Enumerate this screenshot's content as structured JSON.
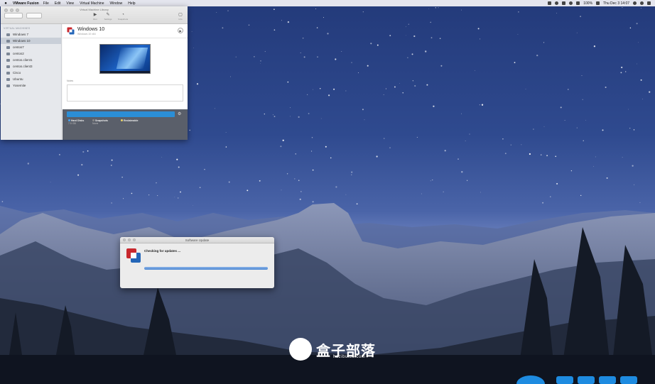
{
  "menubar": {
    "app_name": "VMware Fusion",
    "menus": [
      "File",
      "Edit",
      "View",
      "Virtual Machine",
      "Window",
      "Help"
    ],
    "battery": "100%",
    "clock": "Thu Dec 3 14:07"
  },
  "library": {
    "window_title": "Virtual Machine Library",
    "toolbar": {
      "run_label": "Run",
      "settings_label": "Settings",
      "snapshots_label": "Snapshots",
      "info_label": "Info"
    },
    "section_title": "VIRTUAL MACHINES",
    "items": [
      {
        "label": "Windows 7",
        "selected": false
      },
      {
        "label": "Windows 10",
        "selected": true
      },
      {
        "label": "centos7",
        "selected": false
      },
      {
        "label": "centos2",
        "selected": false
      },
      {
        "label": "centos.client1",
        "selected": false
      },
      {
        "label": "centos.client3",
        "selected": false
      },
      {
        "label": "Cisco",
        "selected": false
      },
      {
        "label": "Ubuntu",
        "selected": false
      },
      {
        "label": "Yosemite",
        "selected": false
      }
    ],
    "detail": {
      "name": "Windows 10",
      "status": "Windows 10 x64",
      "notes_label": "Notes",
      "stats": [
        {
          "label": "Hard Disks",
          "value": "7.5 GB",
          "color": "#4aa3f0"
        },
        {
          "label": "Snapshots",
          "value": "None",
          "color": "#888888"
        },
        {
          "label": "Reclaimable",
          "value": "",
          "color": "#e8d36a"
        }
      ]
    }
  },
  "update_dialog": {
    "title": "Software Update",
    "message": "Checking for updates ...",
    "progress": 1.0
  },
  "watermark": {
    "text": "盒子部落",
    "url": "hezibuluo.com"
  },
  "colors": {
    "accent": "#2b8ed6",
    "sky": "#2f4a8f",
    "vmware_red": "#c8282e",
    "vmware_blue": "#2466b8"
  }
}
